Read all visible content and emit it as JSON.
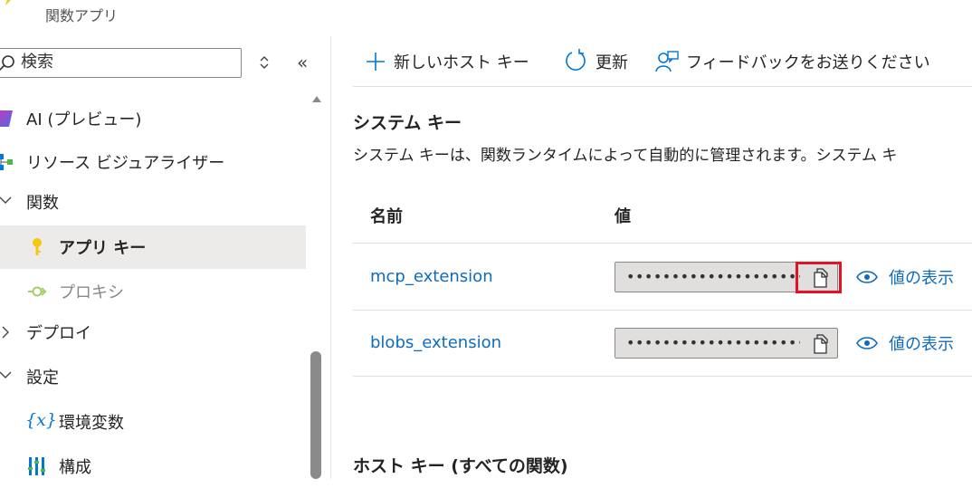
{
  "header": {
    "subtitle": "関数アプリ"
  },
  "sidebar": {
    "search": {
      "placeholder": "検索"
    },
    "items": [
      {
        "label": "AI (プレビュー)",
        "icon": "ai-preview-icon"
      },
      {
        "label": "リソース ビジュアライザー",
        "icon": "resource-visualizer-icon"
      },
      {
        "label": "関数",
        "icon": "chevron-down-icon",
        "expanded": true
      },
      {
        "label": "アプリ キー",
        "icon": "key-icon",
        "selected": true
      },
      {
        "label": "プロキシ",
        "icon": "proxy-icon",
        "disabled": true
      },
      {
        "label": "デプロイ",
        "icon": "chevron-right-icon",
        "expanded": false
      },
      {
        "label": "設定",
        "icon": "chevron-down-icon",
        "expanded": true
      },
      {
        "label": "環境変数",
        "icon": "variables-icon"
      },
      {
        "label": "構成",
        "icon": "configuration-icon"
      }
    ]
  },
  "toolbar": {
    "new_host_key": "新しいホスト キー",
    "refresh": "更新",
    "feedback": "フィードバックをお送りください"
  },
  "system_keys": {
    "title": "システム キー",
    "description": "システム キーは、関数ランタイムによって自動的に管理されます。システム キ",
    "columns": {
      "name": "名前",
      "value": "値"
    },
    "rows": [
      {
        "name": "mcp_extension",
        "value_masked": "••••••••••••••••••••••••...",
        "show_label": "値の表示"
      },
      {
        "name": "blobs_extension",
        "value_masked": "••••••••••••••••••••••••...",
        "show_label": "値の表示"
      }
    ]
  },
  "host_keys": {
    "title": "ホスト キー (すべての関数)"
  },
  "colors": {
    "link": "#0f6cbd",
    "selected_bg": "#edebe9",
    "highlight": "#e81123"
  }
}
